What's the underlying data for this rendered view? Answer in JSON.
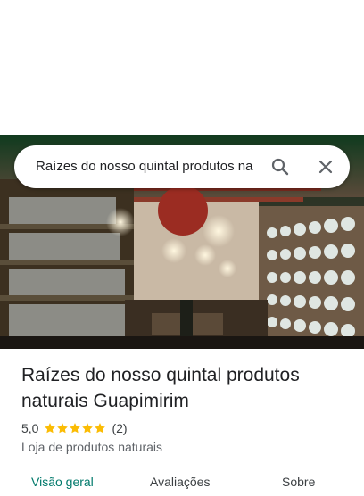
{
  "search": {
    "query": "Raízes do nosso quintal produtos na"
  },
  "place": {
    "title": "Raízes do nosso quintal produtos naturais Guapimirim",
    "rating": "5,0",
    "stars": 5,
    "review_count": "(2)",
    "category": "Loja de produtos naturais"
  },
  "tabs": [
    {
      "label": "Visão geral",
      "active": true
    },
    {
      "label": "Avaliações",
      "active": false
    },
    {
      "label": "Sobre",
      "active": false
    }
  ],
  "colors": {
    "accent": "#00796b",
    "star": "#fbbc04",
    "icon": "#5f6368"
  },
  "icons": {
    "search": "search-icon",
    "close": "close-icon",
    "star": "star-icon"
  }
}
